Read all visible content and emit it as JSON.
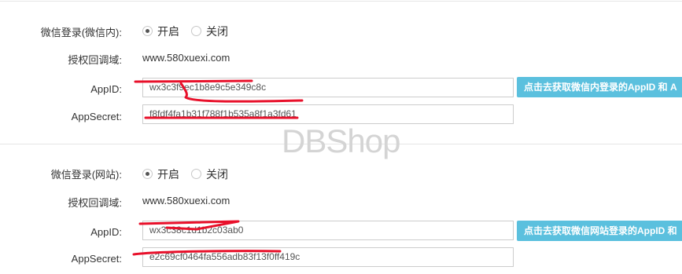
{
  "section1": {
    "login_label": "微信登录(微信内):",
    "radio_on": "开启",
    "radio_off": "关闭",
    "callback_label": "授权回调域:",
    "callback_value": "www.580xuexi.com",
    "appid_label": "AppID:",
    "appid_value": "wx3c3f9ec1b8e9c5e349c8c",
    "appsecret_label": "AppSecret:",
    "appsecret_value": "f8fdf4fa1b31f788f1b535a8f1a3fd61",
    "button_label": "点击去获取微信内登录的AppID 和 A"
  },
  "section2": {
    "login_label": "微信登录(网站):",
    "radio_on": "开启",
    "radio_off": "关闭",
    "callback_label": "授权回调域:",
    "callback_value": "www.580xuexi.com",
    "appid_label": "AppID:",
    "appid_value": "wx3c38c1d1b2c03ab0",
    "appsecret_label": "AppSecret:",
    "appsecret_value": "e2c69cf0464fa556adb83f13f0ff419c",
    "button_label": "点击去获取微信网站登录的AppID 和"
  },
  "watermark": "DBShop",
  "colors": {
    "button": "#5bc0de",
    "redaction": "#e8102a"
  }
}
